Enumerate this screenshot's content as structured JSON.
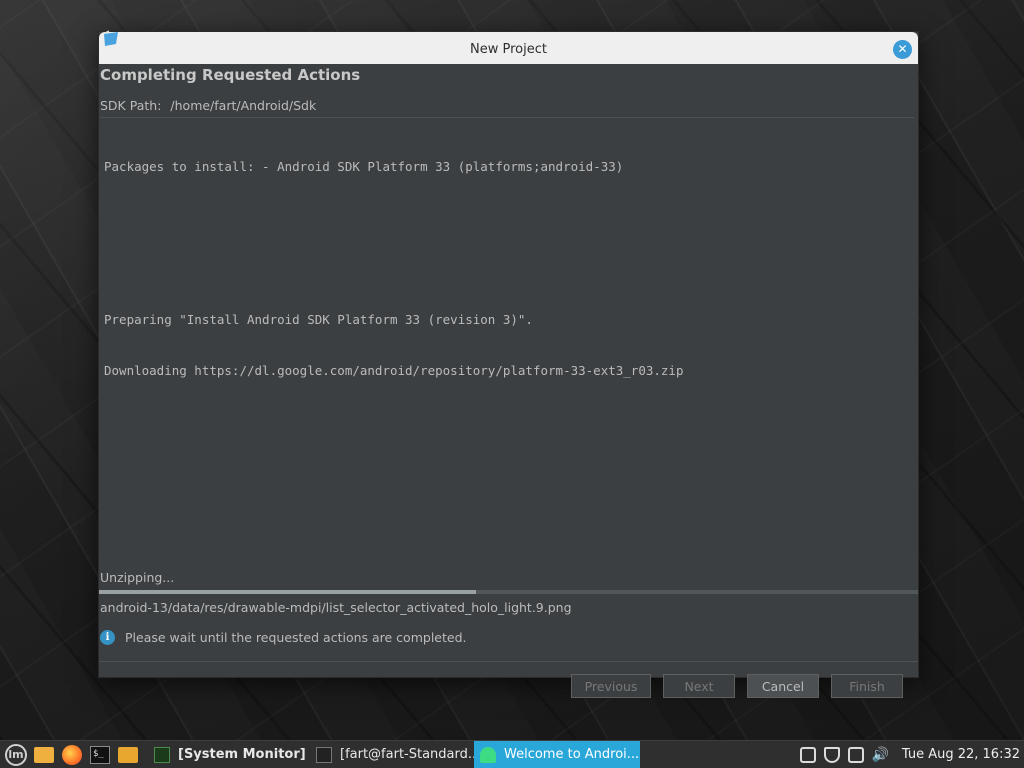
{
  "window": {
    "title": "New Project",
    "heading": "Completing Requested Actions",
    "sdk_label": "SDK Path:",
    "sdk_path": "/home/fart/Android/Sdk",
    "log_lines": [
      "Packages to install: - Android SDK Platform 33 (platforms;android-33)",
      "",
      "",
      "Preparing \"Install Android SDK Platform 33 (revision 3)\".",
      "Downloading https://dl.google.com/android/repository/platform-33-ext3_r03.zip"
    ],
    "status": "Unzipping...",
    "progress": 0.46,
    "current_file": "android-13/data/res/drawable-mdpi/list_selector_activated_holo_light.9.png",
    "info_message": "Please wait until the requested actions are completed.",
    "buttons": {
      "previous": "Previous",
      "next": "Next",
      "cancel": "Cancel",
      "finish": "Finish"
    },
    "close_glyph": "✕"
  },
  "taskbar": {
    "tasks": {
      "system_monitor": "[System Monitor]",
      "terminal": "[fart@fart-Standard...",
      "android": "Welcome to Androi..."
    },
    "clock": "Tue Aug 22, 16:32",
    "volume_glyph": "🔊"
  },
  "colors": {
    "accent": "#2aa7d9",
    "dialog_bg": "#3c3f41",
    "info_icon": "#3592c4"
  }
}
